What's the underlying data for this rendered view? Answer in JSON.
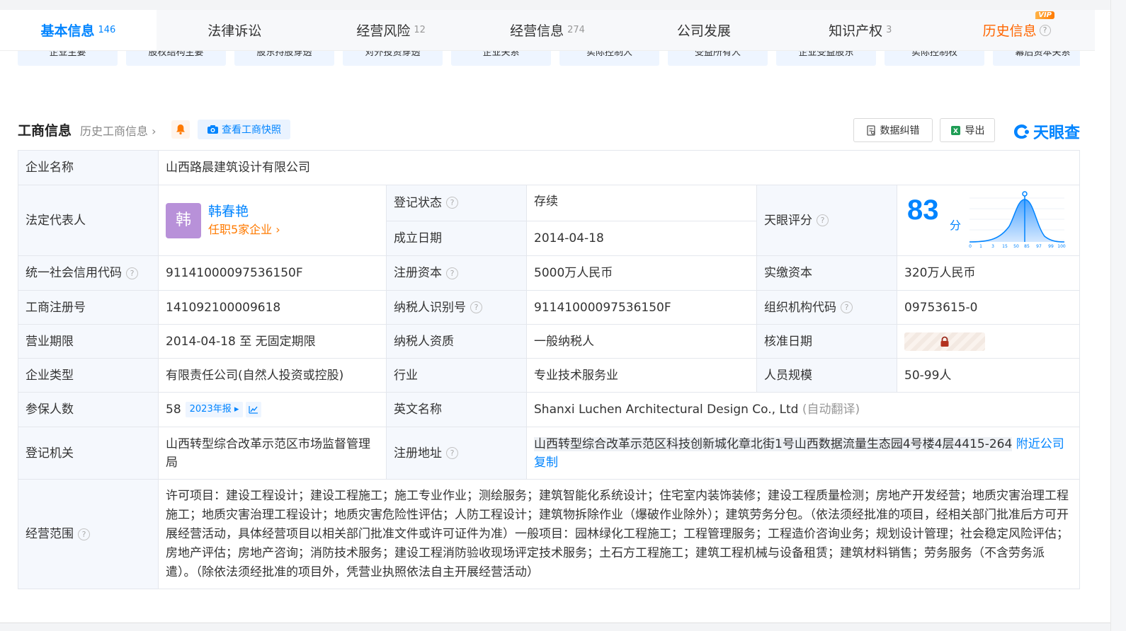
{
  "tabs": [
    {
      "label": "基本信息",
      "count": "146",
      "active": true
    },
    {
      "label": "法律诉讼",
      "count": ""
    },
    {
      "label": "经营风险",
      "count": "12"
    },
    {
      "label": "经营信息",
      "count": "274"
    },
    {
      "label": "公司发展",
      "count": ""
    },
    {
      "label": "知识产权",
      "count": "3"
    },
    {
      "label": "历史信息",
      "count": "",
      "badge": "VIP"
    }
  ],
  "chips": [
    "企业主要",
    "股权结构主要",
    "股东持股穿透",
    "对外投资穿透",
    "企业关系",
    "实际控制人",
    "受益所有人",
    "企业受益股东",
    "实际控制权",
    "幕后资本关系"
  ],
  "section": {
    "title": "工商信息",
    "history_link": "历史工商信息",
    "snapshot_btn": "查看工商快照",
    "correct_btn": "数据纠错",
    "export_btn": "导出",
    "logo_text": "天眼查"
  },
  "info": {
    "company_name_label": "企业名称",
    "company_name": "山西路晨建筑设计有限公司",
    "legal_rep_label": "法定代表人",
    "legal_rep_avatar": "韩",
    "legal_rep_name": "韩春艳",
    "legal_rep_sub": "任职5家企业",
    "reg_status_label": "登记状态",
    "reg_status": "存续",
    "est_date_label": "成立日期",
    "est_date": "2014-04-18",
    "score_label": "天眼评分",
    "score": "83",
    "score_unit": "分",
    "credit_code_label": "统一社会信用代码",
    "credit_code": "91141000097536150F",
    "reg_capital_label": "注册资本",
    "reg_capital": "5000万人民币",
    "paid_capital_label": "实缴资本",
    "paid_capital": "320万人民币",
    "reg_no_label": "工商注册号",
    "reg_no": "141092100009618",
    "taxpayer_id_label": "纳税人识别号",
    "taxpayer_id": "91141000097536150F",
    "org_code_label": "组织机构代码",
    "org_code": "09753615-0",
    "term_label": "营业期限",
    "term": "2014-04-18 至 无固定期限",
    "taxpayer_qual_label": "纳税人资质",
    "taxpayer_qual": "一般纳税人",
    "approve_date_label": "核准日期",
    "type_label": "企业类型",
    "type": "有限责任公司(自然人投资或控股)",
    "industry_label": "行业",
    "industry": "专业技术服务业",
    "staff_label": "人员规模",
    "staff": "50-99人",
    "insured_label": "参保人数",
    "insured": "58",
    "insured_report": "2023年报",
    "english_label": "英文名称",
    "english": "Shanxi Luchen Architectural Design Co., Ltd",
    "english_note": "(自动翻译)",
    "authority_label": "登记机关",
    "authority": "山西转型综合改革示范区市场监督管理局",
    "address_label": "注册地址",
    "address": "山西转型综合改革示范区科技创新城化章北街1号山西数据流量生态园4号楼4层4415-264",
    "nearby_link": "附近公司",
    "copy_link": "复制",
    "scope_label": "经营范围",
    "scope": "许可项目：建设工程设计；建设工程施工；施工专业作业；测绘服务；建筑智能化系统设计；住宅室内装饰装修；建设工程质量检测；房地产开发经营；地质灾害治理工程施工；地质灾害治理工程设计；地质灾害危险性评估；人防工程设计；建筑物拆除作业（爆破作业除外）；建筑劳务分包。（依法须经批准的项目，经相关部门批准后方可开展经营活动，具体经营项目以相关部门批准文件或许可证件为准）一般项目：园林绿化工程施工；工程管理服务；工程造价咨询业务；规划设计管理；社会稳定风险评估；房地产评估；房地产咨询；消防技术服务；建设工程消防验收现场评定技术服务；土石方工程施工；建筑工程机械与设备租赁；建筑材料销售；劳务服务（不含劳务派遣）。（除依法须经批准的项目外，凭营业执照依法自主开展经营活动）"
  },
  "score_chart_ticks": [
    "0",
    "1",
    "3",
    "15",
    "50",
    "85",
    "97",
    "99",
    "100"
  ],
  "colors": {
    "accent": "#0084ff",
    "status_green": "#22a04b",
    "orange": "#ff7a00"
  }
}
